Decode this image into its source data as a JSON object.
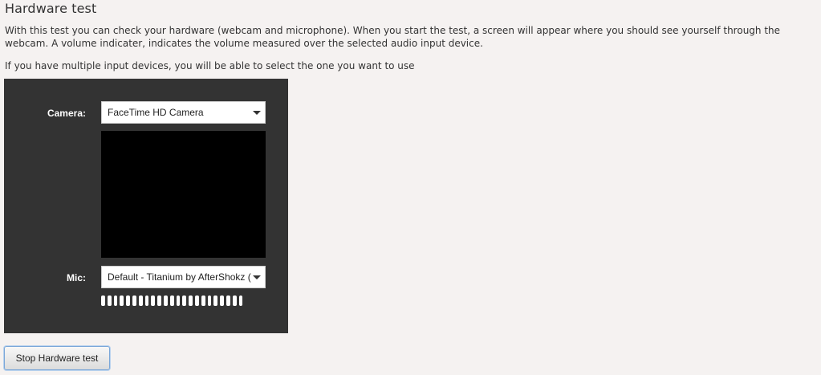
{
  "page": {
    "title": "Hardware test",
    "description": "With this test you can check your hardware (webcam and microphone). When you start the test, a screen will appear where you should see yourself through the webcam. A volume indicater, indicates the volume measured over the selected audio input device.",
    "multi_device_note": "If you have multiple input devices, you will be able to select the one you want to use"
  },
  "camera": {
    "label": "Camera:",
    "selected": "FaceTime HD Camera",
    "icon": "chevron-down-icon"
  },
  "mic": {
    "label": "Mic:",
    "selected": "Default - Titanium by AfterShokz (",
    "icon": "chevron-down-icon"
  },
  "volume_meter": {
    "bars_total": 23,
    "level": 1.0,
    "color": "#ffffff"
  },
  "colors": {
    "panel_bg": "#333333",
    "page_bg": "#f5f2f1",
    "video_bg": "#000000",
    "button_focus": "#7aa7d9"
  },
  "actions": {
    "stop_label": "Stop Hardware test"
  }
}
